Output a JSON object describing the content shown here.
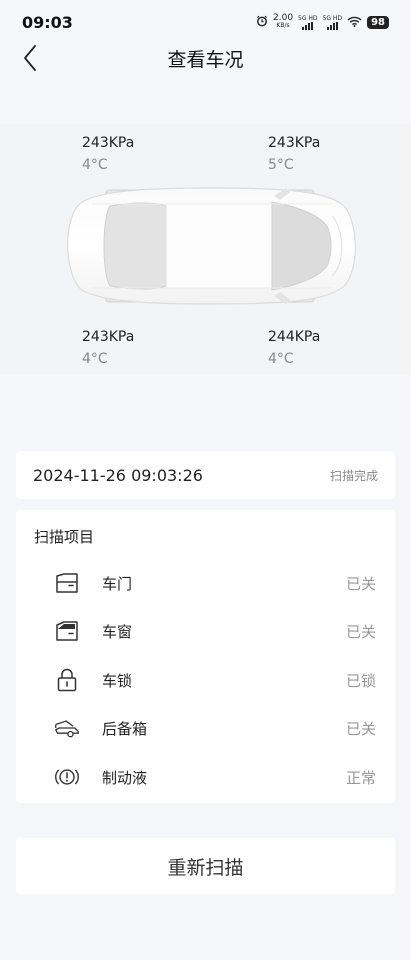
{
  "status_bar": {
    "time": "09:03",
    "net_speed_value": "2.00",
    "net_speed_unit": "KB/s",
    "signal_1": "5G HD",
    "signal_2": "5G HD",
    "battery": "98"
  },
  "header": {
    "title": "查看车况"
  },
  "tires": {
    "front_left": {
      "pressure": "243KPa",
      "temperature": "4°C"
    },
    "front_right": {
      "pressure": "243KPa",
      "temperature": "5°C"
    },
    "rear_left": {
      "pressure": "243KPa",
      "temperature": "4°C"
    },
    "rear_right": {
      "pressure": "244KPa",
      "temperature": "4°C"
    }
  },
  "scan": {
    "datetime": "2024-11-26 09:03:26",
    "status": "扫描完成"
  },
  "items": {
    "title": "扫描项目",
    "rows": [
      {
        "label": "车门",
        "value": "已关",
        "icon": "car-door-icon"
      },
      {
        "label": "车窗",
        "value": "已关",
        "icon": "car-window-icon"
      },
      {
        "label": "车锁",
        "value": "已锁",
        "icon": "lock-icon"
      },
      {
        "label": "后备箱",
        "value": "已关",
        "icon": "trunk-icon"
      },
      {
        "label": "制动液",
        "value": "正常",
        "icon": "brake-fluid-icon"
      }
    ]
  },
  "actions": {
    "rescan_label": "重新扫描"
  }
}
